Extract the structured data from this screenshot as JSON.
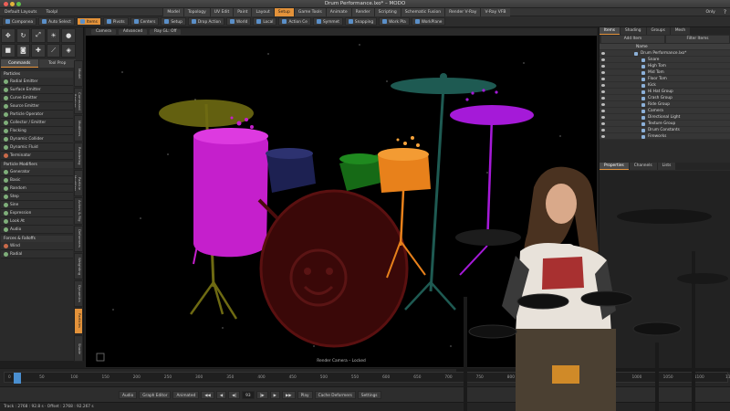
{
  "window": {
    "title": "Drum Performance.lxo* – MODO"
  },
  "menubar": {
    "layout": "Default Layouts",
    "menus": [
      "Toolpl"
    ],
    "tabs": [
      {
        "label": "Model",
        "active": false
      },
      {
        "label": "Topology",
        "active": false
      },
      {
        "label": "UV Edit",
        "active": false
      },
      {
        "label": "Paint",
        "active": false
      },
      {
        "label": "Layout",
        "active": false
      },
      {
        "label": "Setup",
        "active": true
      },
      {
        "label": "Game Tools",
        "active": false
      },
      {
        "label": "Animate",
        "active": false
      },
      {
        "label": "Render",
        "active": false
      },
      {
        "label": "Scripting",
        "active": false
      },
      {
        "label": "Schematic Fusion",
        "active": false
      },
      {
        "label": "Render V-Ray",
        "active": false
      },
      {
        "label": "V-Ray VFB",
        "active": false
      }
    ],
    "right_label": "Only"
  },
  "toolbar": {
    "buttons": [
      {
        "label": "Componea",
        "orange": false
      },
      {
        "label": "Auto Select",
        "orange": false
      },
      {
        "label": "Items",
        "orange": true
      },
      {
        "label": "Pivots",
        "orange": false
      },
      {
        "label": "Centers",
        "orange": false
      },
      {
        "label": "Setup",
        "orange": false
      },
      {
        "label": "Drop Action",
        "orange": false
      },
      {
        "label": "World",
        "orange": false
      },
      {
        "label": "Local",
        "orange": false
      },
      {
        "label": "Action Ce",
        "orange": false
      },
      {
        "label": "Symmet",
        "orange": false
      },
      {
        "label": "Snapping",
        "orange": false
      },
      {
        "label": "Work Pla",
        "orange": false
      },
      {
        "label": "WorkPlane",
        "orange": false
      }
    ]
  },
  "left_panel": {
    "tabs": [
      {
        "label": "Commands",
        "active": true
      },
      {
        "label": "Tool Prop",
        "active": false
      }
    ],
    "sections": [
      {
        "title": "Particles",
        "items": [
          "Radial Emitter",
          "Surface Emitter",
          "Curve Emitter",
          "Source Emitter",
          "Particle Operator",
          "Collector / Emitter",
          "Flocking",
          "Dynamic Collider",
          "Dynamic Fluid",
          "Terminator"
        ]
      },
      {
        "title": "Particle Modifiers",
        "items": [
          "Generator",
          "Basic",
          "Random",
          "Step",
          "Sine",
          "Expression",
          "Look At",
          "Audio"
        ]
      },
      {
        "title": "Forces & Falloffs",
        "items": [
          "Wind",
          "Radial"
        ]
      }
    ],
    "vertical_tabs": [
      {
        "label": "Model",
        "active": false
      },
      {
        "label": "Command Regions",
        "active": false
      },
      {
        "label": "Modifiers",
        "active": false
      },
      {
        "label": "Rendering",
        "active": false
      },
      {
        "label": "Particle Modifiers",
        "active": false
      },
      {
        "label": "Actors & Rig",
        "active": false
      },
      {
        "label": "Deformers",
        "active": false
      },
      {
        "label": "Weighting",
        "active": false
      },
      {
        "label": "Dynamics",
        "active": false
      },
      {
        "label": "Particles",
        "active": true
      },
      {
        "label": "Shade",
        "active": false
      }
    ]
  },
  "viewport": {
    "tabs": [
      "Camera",
      "Advanced",
      "Ray GL: Off"
    ],
    "footer": "Render Camera – Locked"
  },
  "right_panel": {
    "top_tabs": [
      {
        "label": "Items",
        "active": true
      },
      {
        "label": "Shading",
        "active": false
      },
      {
        "label": "Groups",
        "active": false
      },
      {
        "label": "Mesh",
        "active": false
      }
    ],
    "buttons": [
      "Add Item",
      "Filter Items"
    ],
    "list_header": "Name",
    "items": [
      {
        "label": "Drum Performance.lxo*",
        "indent": 0
      },
      {
        "label": "Snare",
        "indent": 1
      },
      {
        "label": "High Tom",
        "indent": 1
      },
      {
        "label": "Mid Tom",
        "indent": 1
      },
      {
        "label": "Floor Tom",
        "indent": 1
      },
      {
        "label": "Kick",
        "indent": 1
      },
      {
        "label": "Hi Hat Group",
        "indent": 1
      },
      {
        "label": "Crash Group",
        "indent": 1
      },
      {
        "label": "Ride Group",
        "indent": 1
      },
      {
        "label": "Camera",
        "indent": 1
      },
      {
        "label": "Directional Light",
        "indent": 1
      },
      {
        "label": "Texture Group",
        "indent": 1
      },
      {
        "label": "Drum Constants",
        "indent": 1
      },
      {
        "label": "Fireworks",
        "indent": 1
      }
    ],
    "lower_tabs": [
      {
        "label": "Properties",
        "active": true
      },
      {
        "label": "Channels",
        "active": false
      },
      {
        "label": "Lists",
        "active": false
      }
    ]
  },
  "timeline": {
    "ticks": [
      "0",
      "50",
      "100",
      "150",
      "200",
      "250",
      "300",
      "350",
      "400",
      "450",
      "500",
      "550",
      "600",
      "650",
      "700",
      "750",
      "800",
      "850",
      "900",
      "950",
      "1000",
      "1050",
      "1100",
      "1150"
    ]
  },
  "transport": {
    "buttons": [
      {
        "label": "Audio",
        "kind": "btn"
      },
      {
        "label": "Graph Editor",
        "kind": "btn"
      },
      {
        "label": "Animated",
        "kind": "btn"
      },
      {
        "label": "◀◀",
        "kind": "btn"
      },
      {
        "label": "◀",
        "kind": "btn"
      },
      {
        "label": "◀|",
        "kind": "btn"
      },
      {
        "label": "93",
        "kind": "field"
      },
      {
        "label": "|▶",
        "kind": "btn"
      },
      {
        "label": "▶",
        "kind": "btn"
      },
      {
        "label": "▶▶",
        "kind": "btn"
      },
      {
        "label": "Play",
        "kind": "btn"
      },
      {
        "label": "Cache Deformers",
        "kind": "btn"
      },
      {
        "label": "Settings",
        "kind": "btn"
      }
    ]
  },
  "status": {
    "text": "Track : 2768 : 92.8 s · Offset : 2768 : 92.267 s"
  },
  "colors": {
    "accent": "#e3923a",
    "selection": "#4a8fd0"
  }
}
